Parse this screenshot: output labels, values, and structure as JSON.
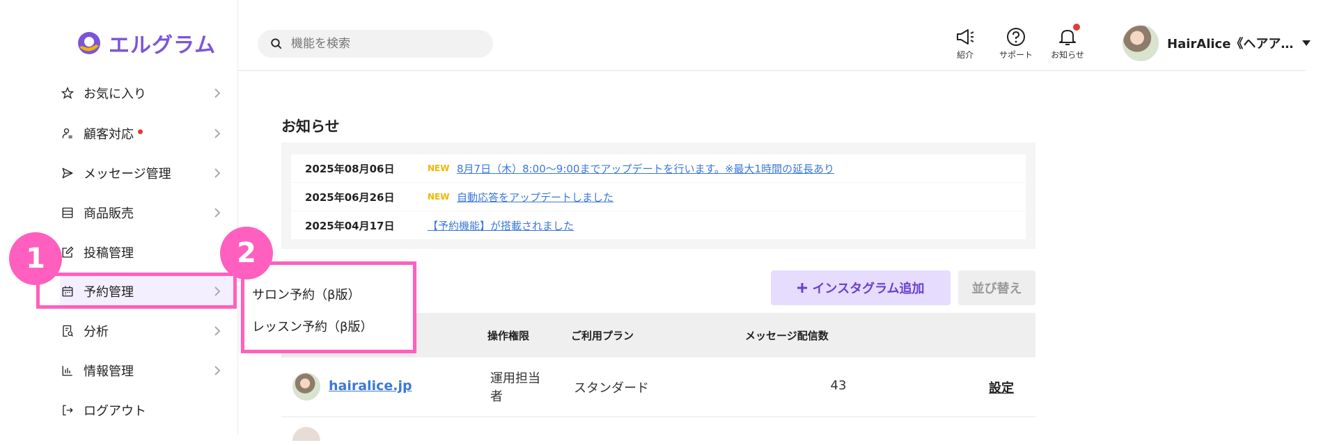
{
  "brand": {
    "name": "エルグラム",
    "color": "#7b55d8"
  },
  "search": {
    "placeholder": "機能を検索"
  },
  "header_icons": [
    {
      "label": "紹介",
      "icon": "megaphone-icon"
    },
    {
      "label": "サポート",
      "icon": "help-circle-icon"
    },
    {
      "label": "お知らせ",
      "icon": "bell-icon"
    }
  ],
  "user": {
    "name": "HairAlice《ヘアア…"
  },
  "sidebar": {
    "items": [
      {
        "label": "お気に入り",
        "icon": "star-icon"
      },
      {
        "label": "顧客対応",
        "icon": "person-icon"
      },
      {
        "label": "メッセージ管理",
        "icon": "send-icon"
      },
      {
        "label": "商品販売",
        "icon": "store-icon"
      },
      {
        "label": "投稿管理",
        "icon": "edit-icon"
      },
      {
        "label": "予約管理",
        "icon": "calendar-icon"
      },
      {
        "label": "分析",
        "icon": "report-icon"
      },
      {
        "label": "情報管理",
        "icon": "bar-chart-icon"
      },
      {
        "label": "ログアウト",
        "icon": "logout-icon"
      }
    ]
  },
  "flyout": {
    "items": [
      {
        "label": "サロン予約（β版）"
      },
      {
        "label": "レッスン予約（β版）"
      }
    ]
  },
  "notices": {
    "title": "お知らせ",
    "items": [
      {
        "date": "2025年08月06日",
        "badge": "NEW",
        "text": "8月7日（木）8:00〜9:00までアップデートを行います。※最大1時間の延長あり"
      },
      {
        "date": "2025年06月26日",
        "badge": "NEW",
        "text": "自動応答をアップデートしました"
      },
      {
        "date": "2025年04月17日",
        "badge": "",
        "text": "【予約機能】が搭載されました"
      }
    ]
  },
  "buttons": {
    "add": "インスタグラム追加",
    "sort": "並び替え"
  },
  "table": {
    "headers": {
      "permission": "操作権限",
      "plan": "ご利用プラン",
      "messages": "メッセージ配信数"
    },
    "rows": [
      {
        "account": "hairalice.jp",
        "permission": "運用担当者",
        "plan": "スタンダード",
        "messages": "43",
        "action": "設定"
      }
    ]
  },
  "annotations": {
    "step1": "1",
    "step2": "2",
    "highlight_color": "#ff5fbe"
  }
}
